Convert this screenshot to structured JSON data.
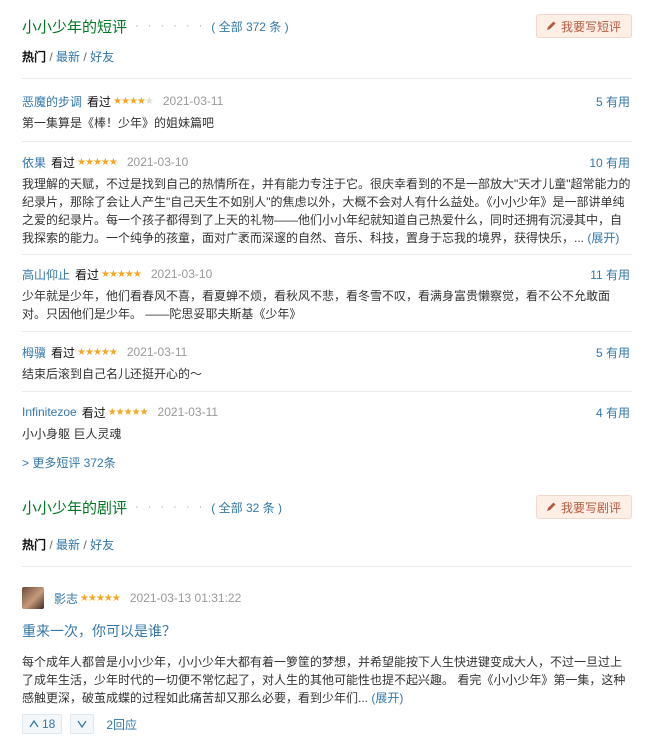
{
  "short_reviews": {
    "title": "小小少年的短评",
    "dots": "· · · · · ·",
    "count": "( 全部 372 条 )",
    "write_button": "我要写短评",
    "filters": {
      "hot": "热门",
      "sep1": " / ",
      "latest": "最新",
      "sep2": " / ",
      "friends": "好友"
    },
    "items": [
      {
        "user": "恶魔的步调",
        "seen": "看过",
        "rating": 4,
        "date": "2021-03-11",
        "votes": "5 有用",
        "text": "第一集算是《棒！少年》的姐妹篇吧",
        "expand": ""
      },
      {
        "user": "依果",
        "seen": "看过",
        "rating": 5,
        "date": "2021-03-10",
        "votes": "10 有用",
        "text": "我理解的天赋，不过是找到自己的热情所在，并有能力专注于它。很庆幸看到的不是一部放大\"天才儿童\"超常能力的纪录片，那除了会让人产生\"自己天生不如别人\"的焦虑以外，大概不会对人有什么益处。《小小少年》是一部讲单纯之爱的纪录片。每一个孩子都得到了上天的礼物——他们小小年纪就知道自己热爱什么，同时还拥有沉浸其中，自我探索的能力。一个纯争的孩童，面对广袤而深邃的自然、音乐、科技，置身于忘我的境界，获得快乐，...",
        "expand": " (展开)"
      },
      {
        "user": "高山仰止",
        "seen": "看过",
        "rating": 5,
        "date": "2021-03-10",
        "votes": "11 有用",
        "text": "少年就是少年，他们看春风不喜，看夏蝉不烦，看秋风不悲，看冬雪不叹，看满身富贵懒察觉，看不公不允敢面对。只因他们是少年。 ——陀思妥耶夫斯基《少年》",
        "expand": ""
      },
      {
        "user": "栂骥",
        "seen": "看过",
        "rating": 5,
        "date": "2021-03-11",
        "votes": "5 有用",
        "text": "结束后滚到自己名儿还挺开心的～",
        "expand": ""
      },
      {
        "user": "Infinitezoe",
        "seen": "看过",
        "rating": 5,
        "date": "2021-03-11",
        "votes": "4 有用",
        "text": "小小身躯 巨人灵魂",
        "expand": ""
      }
    ],
    "more_link": "> 更多短评 372条"
  },
  "long_reviews": {
    "title": "小小少年的剧评",
    "dots": "· · · · · ·",
    "count": "( 全部 32 条 )",
    "write_button": "我要写剧评",
    "filters": {
      "hot": "热门",
      "sep1": " / ",
      "latest": "最新",
      "sep2": " / ",
      "friends": "好友"
    },
    "review": {
      "user": "影志",
      "rating": 5,
      "date": "2021-03-13 01:31:22",
      "title": "重来一次，你可以是谁？",
      "body": "每个成年人都曾是小小少年，小小少年大都有着一箩筐的梦想，并希望能按下人生快进键变成大人，不过一旦过上了成年生活，少年时代的一切便不常忆起了，对人生的其他可能性也提不起兴趣。 看完《小小少年》第一集，这种感触更深，破茧成蝶的过程如此痛苦却又那么必要，看到少年们...",
      "expand": " (展开)",
      "up_count": "18",
      "replies": "2回应"
    }
  },
  "colors": {
    "green_title": "#007722",
    "link": "#3377aa",
    "star": "#f6a623",
    "button_bg": "#fdeee6"
  }
}
